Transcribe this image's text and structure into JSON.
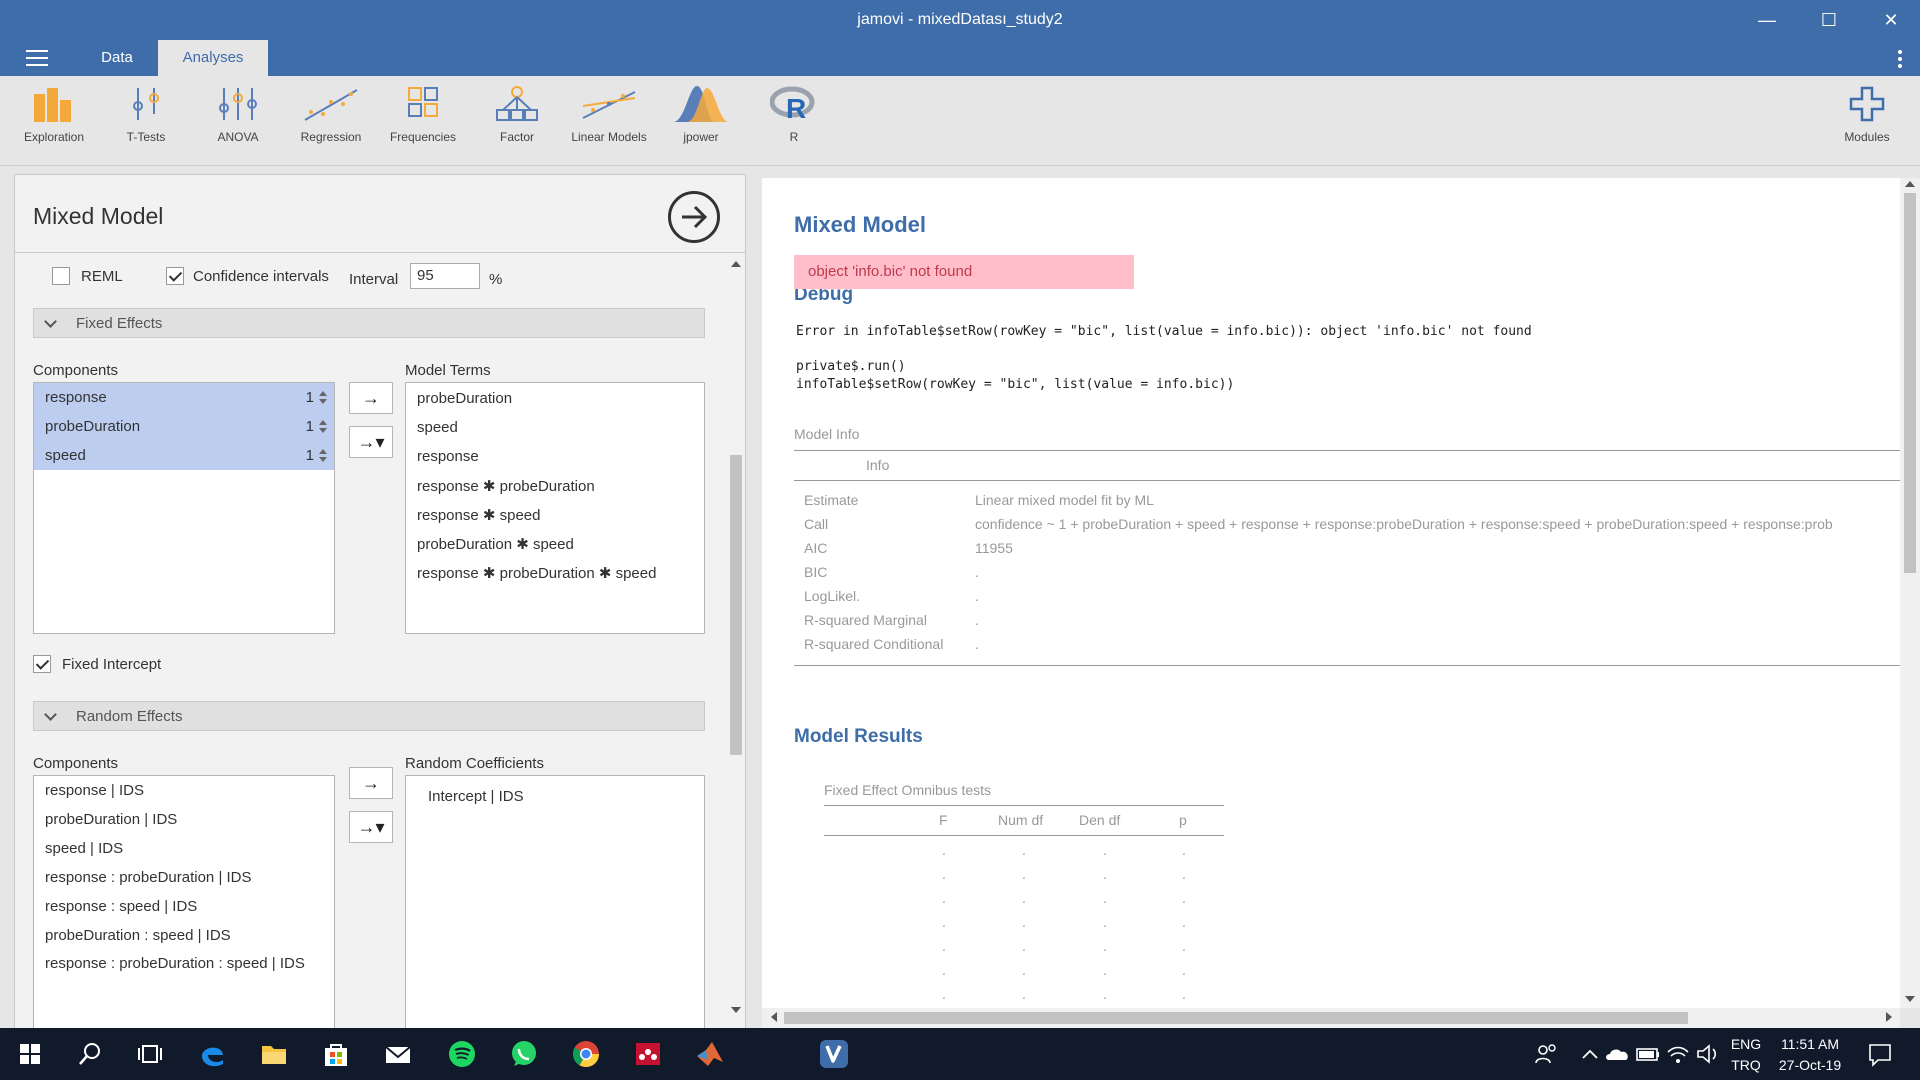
{
  "window": {
    "title": "jamovi - mixedDatası_study2",
    "minimize": "—",
    "maximize": "☐",
    "close": "✕"
  },
  "tabs": [
    {
      "label": "Data"
    },
    {
      "label": "Analyses"
    }
  ],
  "ribbon": [
    {
      "label": "Exploration",
      "icon": "exploration-icon"
    },
    {
      "label": "T-Tests",
      "icon": "t-tests-icon"
    },
    {
      "label": "ANOVA",
      "icon": "anova-icon"
    },
    {
      "label": "Regression",
      "icon": "regression-icon"
    },
    {
      "label": "Frequencies",
      "icon": "frequencies-icon"
    },
    {
      "label": "Factor",
      "icon": "factor-icon"
    },
    {
      "label": "Linear Models",
      "icon": "linear-models-icon"
    },
    {
      "label": "jpower",
      "icon": "jpower-icon"
    },
    {
      "label": "R",
      "icon": "r-icon"
    },
    {
      "label": "Modules",
      "icon": "modules-plus-icon"
    }
  ],
  "colors": {
    "accent": "#3e6da9",
    "selection": "#bccdef",
    "error_bg": "#ffbec9",
    "error_fg": "#c0394f"
  },
  "options": {
    "title": "Mixed Model",
    "reml_label": "REML",
    "reml_checked": false,
    "ci_label": "Confidence intervals",
    "ci_checked": true,
    "interval_label": "Interval",
    "interval_value": "95",
    "percent": "%",
    "fixed_effects": {
      "header": "Fixed Effects",
      "components_label": "Components",
      "components": [
        {
          "name": "response",
          "count": "1"
        },
        {
          "name": "probeDuration",
          "count": "1"
        },
        {
          "name": "speed",
          "count": "1"
        }
      ],
      "model_terms_label": "Model Terms",
      "model_terms": [
        "probeDuration",
        "speed",
        "response",
        "response ✱ probeDuration",
        "response ✱ speed",
        "probeDuration ✱ speed",
        "response ✱ probeDuration ✱ speed"
      ],
      "move_label": "→",
      "interaction_label": "→▾"
    },
    "fixed_intercept_label": "Fixed Intercept",
    "fixed_intercept_checked": true,
    "random_effects": {
      "header": "Random Effects",
      "components_label": "Components",
      "components": [
        "response | IDS",
        "probeDuration | IDS",
        "speed | IDS",
        "response : probeDuration | IDS",
        "response : speed | IDS",
        "probeDuration : speed | IDS",
        "response : probeDuration : speed | IDS"
      ],
      "coefficients_label": "Random Coefficients",
      "coefficients": [
        "Intercept | IDS"
      ]
    }
  },
  "results": {
    "title": "Mixed Model",
    "error": "object 'info.bic' not found",
    "debug_title": "Debug",
    "debug_lines": [
      "Error in infoTable$setRow(rowKey = \"bic\", list(value = info.bic)): object 'info.bic' not found",
      "",
      "private$.run()",
      "infoTable$setRow(rowKey = \"bic\", list(value = info.bic))"
    ],
    "model_info": {
      "title": "Model Info",
      "col_header": "Info",
      "rows": [
        {
          "label": "Estimate",
          "value": "Linear mixed model fit by ML"
        },
        {
          "label": "Call",
          "value": "confidence ~ 1 + probeDuration + speed + response + response:probeDuration + response:speed + probeDuration:speed + response:prob"
        },
        {
          "label": "AIC",
          "value": "11955"
        },
        {
          "label": "BIC",
          "value": "."
        },
        {
          "label": "LogLikel.",
          "value": "."
        },
        {
          "label": "R-squared Marginal",
          "value": "."
        },
        {
          "label": "R-squared Conditional",
          "value": "."
        }
      ]
    },
    "model_results_title": "Model Results",
    "omnibus": {
      "title": "Fixed Effect Omnibus tests",
      "columns": [
        "F",
        "Num df",
        "Den df",
        "p"
      ],
      "dot": "."
    }
  },
  "taskbar": {
    "lang_top": "ENG",
    "lang_bottom": "TRQ",
    "time": "11:51 AM",
    "date": "27-Oct-19"
  }
}
